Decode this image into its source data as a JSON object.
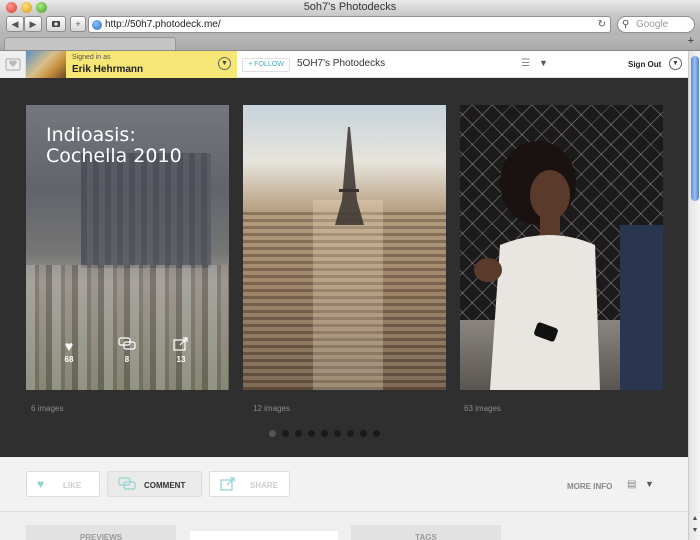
{
  "window": {
    "title": "5oh7's Photodecks"
  },
  "toolbar": {
    "back": "◀",
    "forward": "▶",
    "plus": "+",
    "url": "http://50h7.photodeck.me/",
    "search_placeholder": "Google"
  },
  "site": {
    "signed_in_label": "Signed in as",
    "user_name": "Erik Hehrmann",
    "follow_label": "+ FOLLOW",
    "site_name": "5OH7's Photodecks",
    "sign_out_label": "Sign Out"
  },
  "gallery": {
    "cards": [
      {
        "title": "Indioasis: Cochella 2010",
        "likes": "68",
        "comments": "8",
        "shares": "13",
        "caption": "6 images"
      },
      {
        "caption": "12 images"
      },
      {
        "caption": "63 images"
      }
    ],
    "pagination": {
      "count": 9,
      "active_index": 0
    }
  },
  "actions": {
    "like_label": "LIKE",
    "comment_label": "COMMENT",
    "share_label": "SHARE",
    "more_info_label": "MORE INFO"
  },
  "tabs": {
    "previews_label": "PREVIEWS",
    "tags_label": "TAGS"
  },
  "icons": {
    "heart": "heart-icon",
    "comment": "comment-icon",
    "share": "share-icon",
    "list": "list-icon",
    "caret": "chevron-down-icon",
    "reload": "reload-icon",
    "search": "search-icon"
  },
  "colors": {
    "accent_teal": "#8fd3cf",
    "signed_bg": "#f5e676",
    "gallery_bg": "#2f2f2f"
  }
}
